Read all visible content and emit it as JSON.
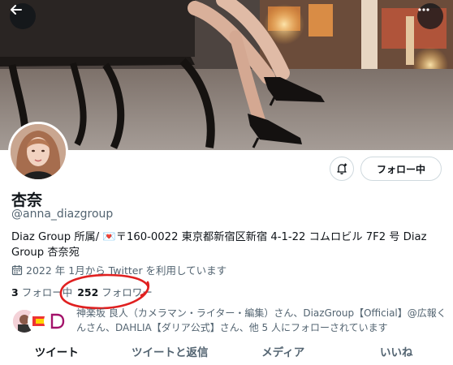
{
  "header": {
    "back_icon": "arrow-left-icon",
    "more_icon": "more-horizontal-icon"
  },
  "profile": {
    "display_name": "杏奈",
    "handle": "@anna_diazgroup",
    "bio": "Diaz Group 所属/ 💌〒160-0022 東京都新宿区新宿 4-1-22 コムロビル 7F2 号 Diaz Group 杏奈宛",
    "joined": "2022 年 1月から Twitter を利用しています",
    "joined_icon": "calendar-icon"
  },
  "actions": {
    "notify_icon": "bell-plus-icon",
    "follow_label": "フォロー中"
  },
  "stats": {
    "following_count": "3",
    "following_label": "フォロー中",
    "followers_count": "252",
    "followers_label": "フォロワー"
  },
  "annotation": {
    "highlight_color": "#e02020"
  },
  "followed_by": {
    "text": "神楽坂 良人（カメラマン・ライター・編集）さん、DiazGroup【Official】@広報くんさん、DAHLIA【ダリア公式】さん、他 5 人にフォローされています"
  },
  "tabs": [
    "ツイート",
    "ツイートと返信",
    "メディア",
    "いいね"
  ]
}
